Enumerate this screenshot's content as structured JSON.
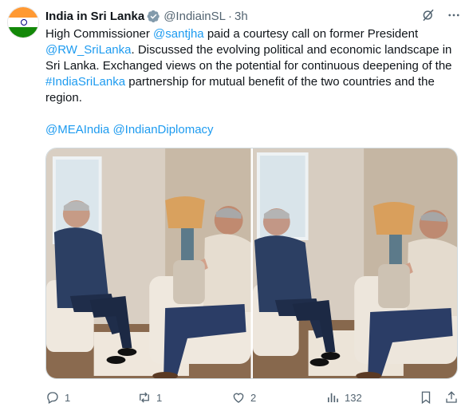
{
  "tweet": {
    "author_name": "India in Sri Lanka",
    "handle": "@IndiainSL",
    "time": "3h",
    "separator": "·",
    "text": {
      "p1_a": "High Commissioner ",
      "p1_mention1": "@santjha",
      "p1_b": " paid a courtesy call on former President ",
      "p1_mention2": "@RW_SriLanka",
      "p1_c": ". Discussed the evolving political and economic landscape in Sri Lanka. Exchanged views on the potential for continuous deepening of the ",
      "p1_hashtag": "#IndiaSriLanka",
      "p1_d": " partnership for mutual benefit of the two countries and the region.",
      "mention_a": "@MEAIndia",
      "mention_b": "@IndianDiplomacy"
    },
    "stats": {
      "replies": "1",
      "retweets": "1",
      "likes": "2",
      "views": "132"
    }
  },
  "icons": {
    "verified": "verified-badge-icon",
    "grok": "grok-icon",
    "more": "more-icon",
    "reply": "reply-icon",
    "retweet": "retweet-icon",
    "like": "heart-icon",
    "views": "views-icon",
    "bookmark": "bookmark-icon",
    "share": "share-icon"
  },
  "colors": {
    "accent": "#1d9bf0",
    "text": "#0f1419",
    "muted": "#536471",
    "saffron": "#ff9933",
    "green": "#138808"
  }
}
